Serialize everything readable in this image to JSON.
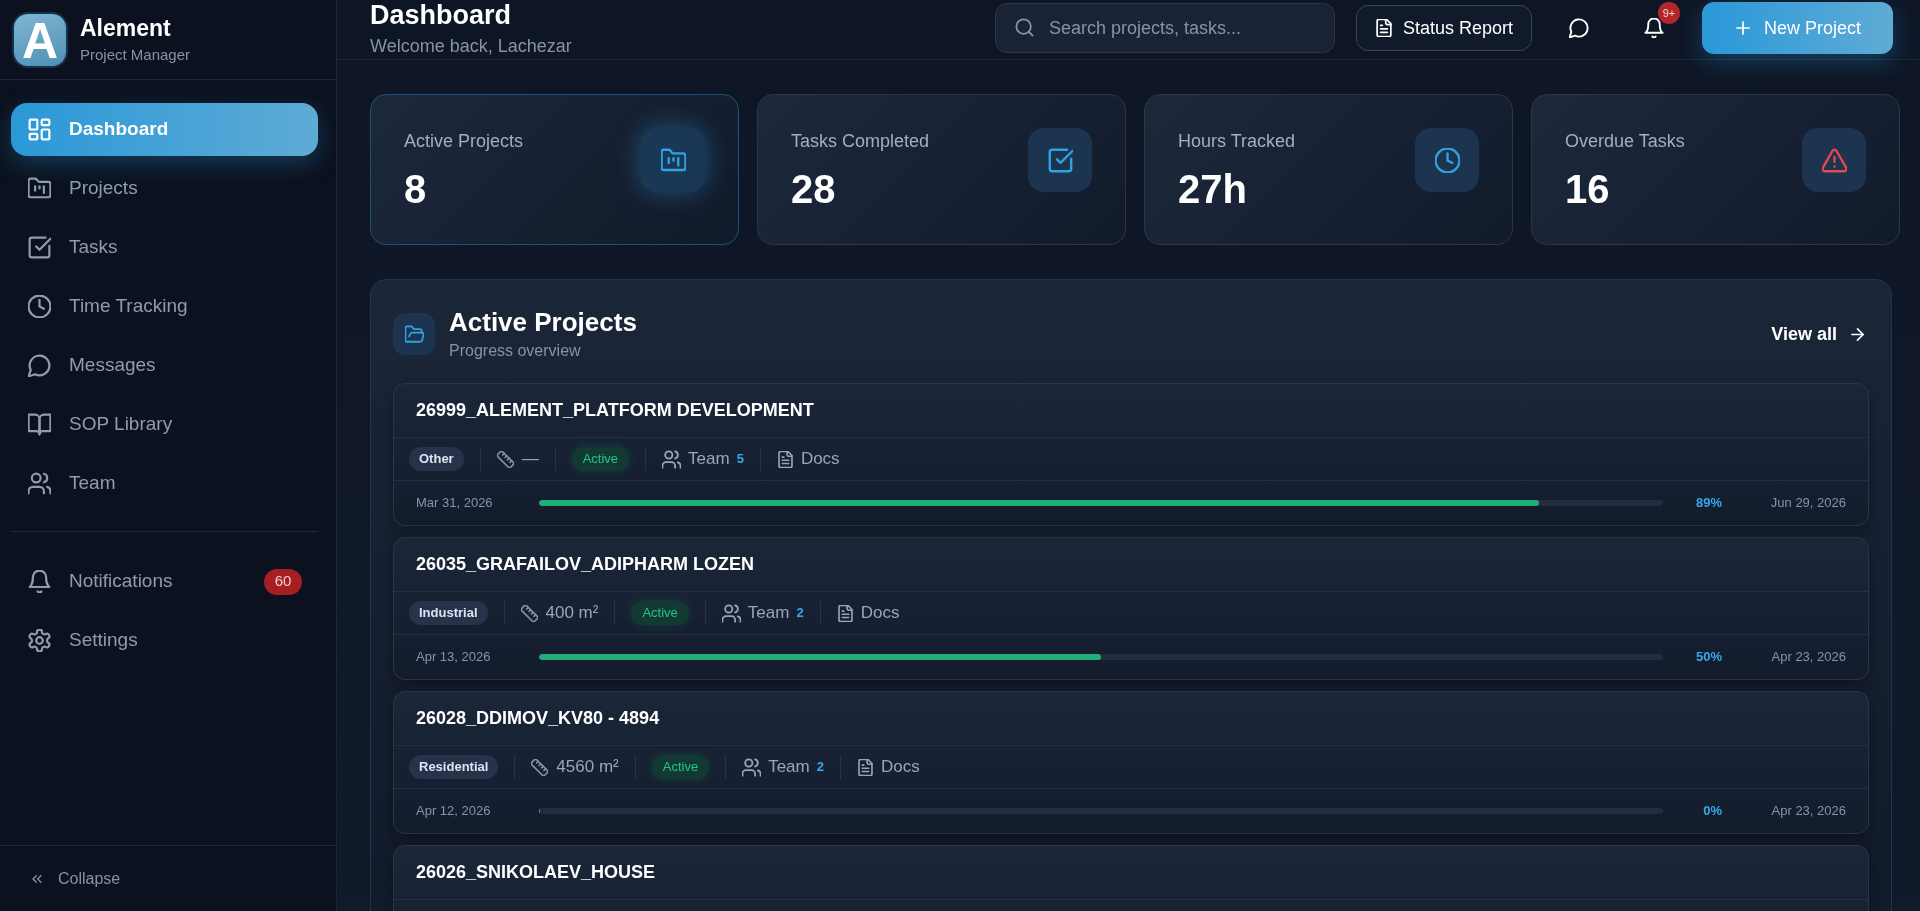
{
  "sidebar": {
    "brand": {
      "logo_letter": "A",
      "title": "Alement",
      "subtitle": "Project Manager"
    },
    "nav": [
      {
        "label": "Dashboard",
        "selected": true
      },
      {
        "label": "Projects",
        "selected": false
      },
      {
        "label": "Tasks",
        "selected": false
      },
      {
        "label": "Time Tracking",
        "selected": false
      },
      {
        "label": "Messages",
        "selected": false
      },
      {
        "label": "SOP Library",
        "selected": false
      },
      {
        "label": "Team",
        "selected": false
      }
    ],
    "secondary": [
      {
        "label": "Notifications",
        "badge": "60",
        "selected": false
      },
      {
        "label": "Settings",
        "selected": false
      }
    ],
    "collapse": {
      "label": "Collapse"
    }
  },
  "header": {
    "title": "Dashboard",
    "subtitle": "Welcome back, Lachezar",
    "search": {
      "placeholder": "Search projects, tasks..."
    },
    "status_report": {
      "label": "Status Report"
    },
    "notifications": {
      "badge": "9+"
    },
    "new_project": {
      "label": "New Project"
    }
  },
  "stats": [
    {
      "label": "Active Projects",
      "value": "8",
      "highlighted": true,
      "color": "#2ea3e0"
    },
    {
      "label": "Tasks Completed",
      "value": "28",
      "highlighted": false,
      "color": "#2ea3e0"
    },
    {
      "label": "Hours Tracked",
      "value": "27h",
      "highlighted": false,
      "color": "#2ea3e0"
    },
    {
      "label": "Overdue Tasks",
      "value": "16",
      "highlighted": false,
      "color": "#e5484d"
    }
  ],
  "active_projects": {
    "title": "Active Projects",
    "subtitle": "Progress overview",
    "view_all": "View all",
    "projects": [
      {
        "name": "26999_ALEMENT_PLATFORM DEVELOPMENT",
        "category": "Other",
        "area": "—",
        "status": "Active",
        "team": "Team",
        "team_count": "5",
        "docs": "Docs",
        "start": "Mar 31, 2026",
        "level": 0.89,
        "percent": "89%",
        "end": "Jun 29, 2026"
      },
      {
        "name": "26035_GRAFAILOV_ADIPHARM LOZEN",
        "category": "Industrial",
        "area": "400 m²",
        "status": "Active",
        "team": "Team",
        "team_count": "2",
        "docs": "Docs",
        "start": "Apr 13, 2026",
        "level": 0.5,
        "percent": "50%",
        "end": "Apr 23, 2026"
      },
      {
        "name": "26028_DDIMOV_KV80 - 4894",
        "category": "Residential",
        "area": "4560 m²",
        "status": "Active",
        "team": "Team",
        "team_count": "2",
        "docs": "Docs",
        "start": "Apr 12, 2026",
        "level": 0,
        "percent": "0%",
        "end": "Apr 23, 2026"
      },
      {
        "name": "26026_SNIKOLAEV_HOUSE"
      }
    ]
  }
}
